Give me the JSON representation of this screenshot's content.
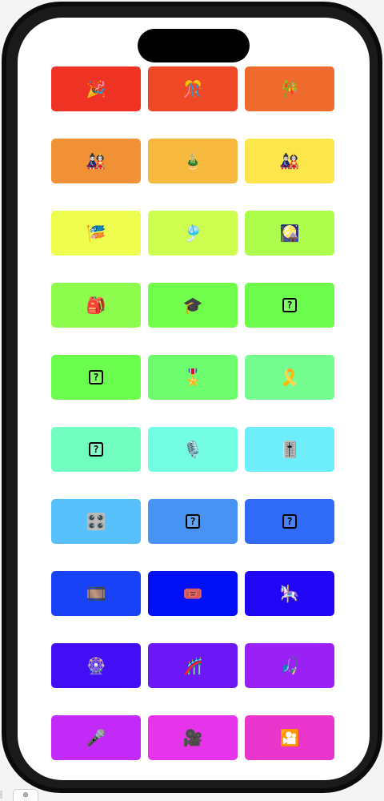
{
  "tiles": [
    {
      "glyph": "🎉",
      "color": "#EE3325",
      "icon": "party-popper-icon",
      "unknown": false
    },
    {
      "glyph": "🎊",
      "color": "#EE4826",
      "icon": "confetti-ball-icon",
      "unknown": false
    },
    {
      "glyph": "🎋",
      "color": "#EE6A2D",
      "icon": "tanabata-tree-icon",
      "unknown": false
    },
    {
      "glyph": "🎎",
      "color": "#F09136",
      "icon": "japanese-dolls-icon",
      "unknown": false
    },
    {
      "glyph": "🎍",
      "color": "#F6B93E",
      "icon": "pine-decoration-icon",
      "unknown": false
    },
    {
      "glyph": "🎎",
      "color": "#FDE64B",
      "icon": "japanese-dolls-icon",
      "unknown": false
    },
    {
      "glyph": "🎏",
      "color": "#EFFD4E",
      "icon": "carp-streamer-icon",
      "unknown": false
    },
    {
      "glyph": "🎐",
      "color": "#CDFD4E",
      "icon": "wind-chime-icon",
      "unknown": false
    },
    {
      "glyph": "🎑",
      "color": "#ADFD4D",
      "icon": "moon-viewing-ceremony-icon",
      "unknown": false
    },
    {
      "glyph": "🎒",
      "color": "#8CFD4C",
      "icon": "school-backpack-icon",
      "unknown": false
    },
    {
      "glyph": "🎓",
      "color": "#71FD4B",
      "icon": "graduation-cap-icon",
      "unknown": false
    },
    {
      "glyph": "?",
      "color": "#6CFD4C",
      "icon": "unknown-glyph-icon",
      "unknown": true
    },
    {
      "glyph": "?",
      "color": "#6BFD4D",
      "icon": "unknown-glyph-icon",
      "unknown": true
    },
    {
      "glyph": "🎖️",
      "color": "#6EFD6E",
      "icon": "military-medal-icon",
      "unknown": false
    },
    {
      "glyph": "🎗️",
      "color": "#75FD8F",
      "icon": "reminder-ribbon-icon",
      "unknown": false
    },
    {
      "glyph": "?",
      "color": "#72FDC0",
      "icon": "unknown-glyph-icon",
      "unknown": true
    },
    {
      "glyph": "🎙️",
      "color": "#73FDE2",
      "icon": "studio-microphone-icon",
      "unknown": false
    },
    {
      "glyph": "🎚️",
      "color": "#6EEDFB",
      "icon": "level-slider-icon",
      "unknown": false
    },
    {
      "glyph": "🎛️",
      "color": "#58C1FB",
      "icon": "control-knobs-icon",
      "unknown": false
    },
    {
      "glyph": "?",
      "color": "#4693F4",
      "icon": "unknown-glyph-icon",
      "unknown": true
    },
    {
      "glyph": "?",
      "color": "#2F6BF6",
      "icon": "unknown-glyph-icon",
      "unknown": true
    },
    {
      "glyph": "🎞️",
      "color": "#1742F5",
      "icon": "film-frames-icon",
      "unknown": false
    },
    {
      "glyph": "🎟️",
      "color": "#0011F5",
      "icon": "admission-tickets-icon",
      "unknown": false
    },
    {
      "glyph": "🎠",
      "color": "#2105F5",
      "icon": "carousel-horse-icon",
      "unknown": false
    },
    {
      "glyph": "🎡",
      "color": "#430DF5",
      "icon": "ferris-wheel-icon",
      "unknown": false
    },
    {
      "glyph": "🎢",
      "color": "#6C17F6",
      "icon": "roller-coaster-icon",
      "unknown": false
    },
    {
      "glyph": "🎣",
      "color": "#9A20F6",
      "icon": "fishing-pole-icon",
      "unknown": false
    },
    {
      "glyph": "🎤",
      "color": "#C42AF7",
      "icon": "microphone-icon",
      "unknown": false
    },
    {
      "glyph": "🎥",
      "color": "#E634EB",
      "icon": "movie-camera-icon",
      "unknown": false
    },
    {
      "glyph": "🎦",
      "color": "#EA35CD",
      "icon": "cinema-icon",
      "unknown": false
    }
  ],
  "corner_widget_symbol": "⊕"
}
